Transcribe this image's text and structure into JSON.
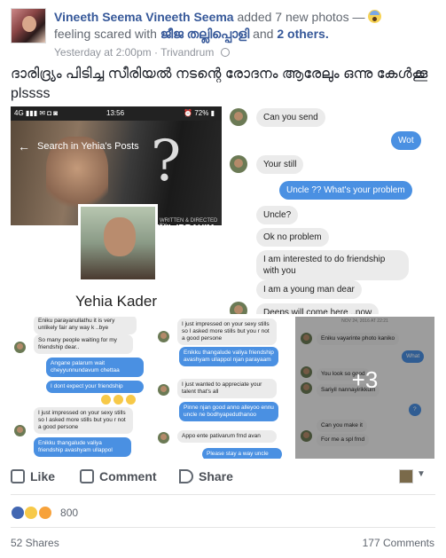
{
  "post": {
    "author": "Vineeth Seema Vineeth Seema",
    "action": "added 7 new photos —",
    "feeling_prefix": "feeling scared with",
    "tagged": "ജീജ തല്ലിപ്പൊളി",
    "and": "and",
    "others": "2 others.",
    "timestamp": "Yesterday at 2:00pm",
    "location": "Trivandrum",
    "text": "ദാരിദ്ര്യം പിടിച്ച സീരിയൽ നടന്റെ രോദനം ആരേലും ഒന്നു കേൾക്കൂ plssss"
  },
  "photo1": {
    "status_left": "4G ▮▮▮ ✉ ◘ ◙",
    "status_time": "13:56",
    "status_right": "⏰ 72% ▮",
    "search_back": "←",
    "search_text": "Search in Yehia's Posts",
    "qmark": "?",
    "director_line": "WRITTEN & DIRECTED BY",
    "director_name": "SUNIL IBRAHIM",
    "profile_name": "Yehia Kader"
  },
  "photo2": {
    "messages": [
      {
        "dir": "in",
        "text": "Can you send"
      },
      {
        "dir": "out",
        "text": "Wot"
      },
      {
        "dir": "in",
        "text": "Your still"
      },
      {
        "dir": "out",
        "text": "Uncle ?? What's your problem"
      },
      {
        "dir": "in",
        "text": "Uncle?"
      },
      {
        "dir": "in",
        "text": "Ok no problem"
      },
      {
        "dir": "in",
        "text": "I am interested to do friendship with you"
      },
      {
        "dir": "in",
        "text": "I am a young man dear"
      },
      {
        "dir": "in",
        "text": "Deeps will come here ..now"
      }
    ]
  },
  "photo3": {
    "messages": [
      {
        "dir": "in",
        "text": "Eniku parayanullathu it is very unlikely fair any way k ..bye"
      },
      {
        "dir": "in",
        "text": "So many people waiting for my friendship dear.."
      },
      {
        "dir": "out",
        "text": "Angane palarum wait cheyyunnundavum chettaa"
      },
      {
        "dir": "out",
        "text": "I dont expect your friendship"
      },
      {
        "dir": "in",
        "text": "I just impressed on your sexy stills so I asked more stills but you r not a good persone"
      },
      {
        "dir": "out",
        "text": "Enikku thangalude valiya friendship avashyam ullappol"
      }
    ]
  },
  "photo4": {
    "messages": [
      {
        "dir": "in",
        "text": "I just impressed on your sexy stills so I asked more stills but you r not a good persone"
      },
      {
        "dir": "out",
        "text": "Enikku thangalude valiya friendship avashyam ullappol njan parayaam"
      },
      {
        "dir": "in",
        "text": "I just wanted to appreciate your talent that's all"
      },
      {
        "dir": "out",
        "text": "Pinne njan good anno alleyoo ennu uncle ne bodhyapeduthanoo"
      },
      {
        "dir": "in",
        "text": "Appo ente pativarum frnd avan"
      },
      {
        "dir": "out",
        "text": "Please stay a way uncle"
      }
    ]
  },
  "photo5": {
    "date_top": "NOV 24, 2016 AT 22:21",
    "messages": [
      {
        "dir": "in",
        "text": "Eniku vayarinte photo kaniko"
      },
      {
        "dir": "out",
        "text": "What"
      },
      {
        "dir": "in",
        "text": "You look so good"
      },
      {
        "dir": "in",
        "text": "Sariyil nannayirikkum"
      },
      {
        "dir": "out",
        "text": "?"
      },
      {
        "dir": "in",
        "text": "Can you make it"
      },
      {
        "dir": "in",
        "text": "For me a spl frnd"
      }
    ],
    "more": "+3"
  },
  "actions": {
    "like": "Like",
    "comment": "Comment",
    "share": "Share"
  },
  "reactions": {
    "count": "800"
  },
  "footer": {
    "shares": "52 Shares",
    "comments": "177 Comments"
  },
  "colors": {
    "link": "#365899",
    "bubble_out": "#4a90e2",
    "bubble_in": "#ebebeb"
  }
}
